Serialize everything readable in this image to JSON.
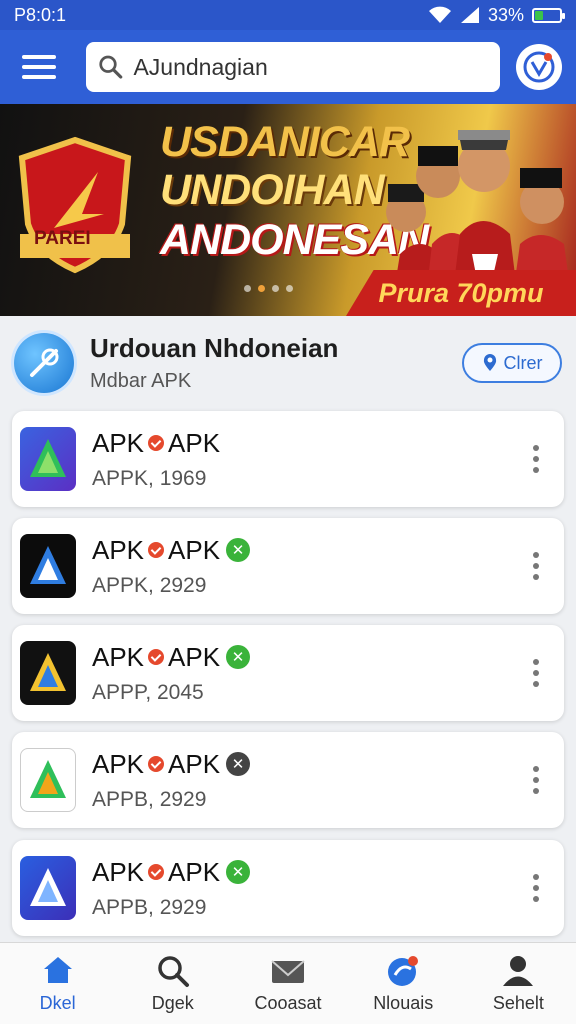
{
  "status_bar": {
    "time": "P8:0:1",
    "battery": "33%",
    "battery_level": 0.33
  },
  "search": {
    "value": "AJundnagian"
  },
  "banner": {
    "badge_text": "PAREI",
    "lines": [
      "USDANICAR",
      "UNDOIHAN",
      "ANDONESAN"
    ],
    "price": "Prura 70pmu",
    "slides": 4,
    "active_slide": 1
  },
  "publisher": {
    "name": "Urdouan Nhdoneian",
    "subtitle": "Mdbar APK",
    "action_label": "Clrer"
  },
  "apps": [
    {
      "title_left": "APK",
      "title_right": "APK",
      "meta": "APPK, 1969",
      "status": "none",
      "icon": "play-triangle-green"
    },
    {
      "title_left": "APK",
      "title_right": "APK",
      "meta": "APPK, 2929",
      "status": "check",
      "icon": "play-triangle-dark"
    },
    {
      "title_left": "APK",
      "title_right": "APK",
      "meta": "APPP, 2045",
      "status": "check",
      "icon": "play-triangle-yellow"
    },
    {
      "title_left": "APK",
      "title_right": "APK",
      "meta": "APPB, 2929",
      "status": "blocked",
      "icon": "play-triangle-white"
    },
    {
      "title_left": "APK",
      "title_right": "APK",
      "meta": "APPB, 2929",
      "status": "check",
      "icon": "play-triangle-blue"
    }
  ],
  "nav": [
    {
      "label": "Dkel",
      "icon": "home-icon"
    },
    {
      "label": "Dgek",
      "icon": "search-icon"
    },
    {
      "label": "Cooasat",
      "icon": "mail-icon"
    },
    {
      "label": "Nlouais",
      "icon": "globe-icon"
    },
    {
      "label": "Sehelt",
      "icon": "user-icon"
    }
  ],
  "colors": {
    "primary": "#2f5fd6",
    "check": "#3ab33a",
    "blocked": "#444444",
    "accent_red": "#e5492d"
  }
}
